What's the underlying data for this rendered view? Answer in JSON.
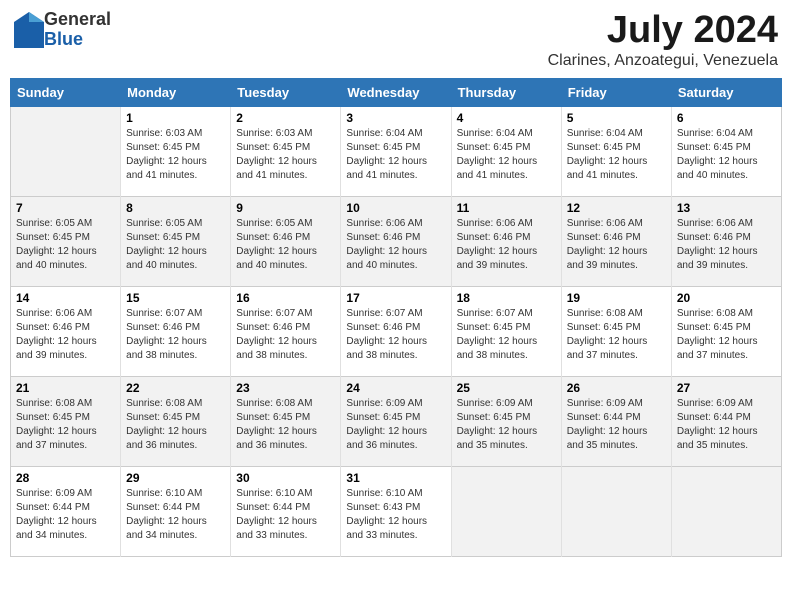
{
  "header": {
    "logo": {
      "line1": "General",
      "line2": "Blue"
    },
    "title": "July 2024",
    "location": "Clarines, Anzoategui, Venezuela"
  },
  "days_of_week": [
    "Sunday",
    "Monday",
    "Tuesday",
    "Wednesday",
    "Thursday",
    "Friday",
    "Saturday"
  ],
  "weeks": [
    [
      {
        "day": "",
        "sunrise": "",
        "sunset": "",
        "daylight": ""
      },
      {
        "day": "1",
        "sunrise": "Sunrise: 6:03 AM",
        "sunset": "Sunset: 6:45 PM",
        "daylight": "Daylight: 12 hours and 41 minutes."
      },
      {
        "day": "2",
        "sunrise": "Sunrise: 6:03 AM",
        "sunset": "Sunset: 6:45 PM",
        "daylight": "Daylight: 12 hours and 41 minutes."
      },
      {
        "day": "3",
        "sunrise": "Sunrise: 6:04 AM",
        "sunset": "Sunset: 6:45 PM",
        "daylight": "Daylight: 12 hours and 41 minutes."
      },
      {
        "day": "4",
        "sunrise": "Sunrise: 6:04 AM",
        "sunset": "Sunset: 6:45 PM",
        "daylight": "Daylight: 12 hours and 41 minutes."
      },
      {
        "day": "5",
        "sunrise": "Sunrise: 6:04 AM",
        "sunset": "Sunset: 6:45 PM",
        "daylight": "Daylight: 12 hours and 41 minutes."
      },
      {
        "day": "6",
        "sunrise": "Sunrise: 6:04 AM",
        "sunset": "Sunset: 6:45 PM",
        "daylight": "Daylight: 12 hours and 40 minutes."
      }
    ],
    [
      {
        "day": "7",
        "sunrise": "Sunrise: 6:05 AM",
        "sunset": "Sunset: 6:45 PM",
        "daylight": "Daylight: 12 hours and 40 minutes."
      },
      {
        "day": "8",
        "sunrise": "Sunrise: 6:05 AM",
        "sunset": "Sunset: 6:45 PM",
        "daylight": "Daylight: 12 hours and 40 minutes."
      },
      {
        "day": "9",
        "sunrise": "Sunrise: 6:05 AM",
        "sunset": "Sunset: 6:46 PM",
        "daylight": "Daylight: 12 hours and 40 minutes."
      },
      {
        "day": "10",
        "sunrise": "Sunrise: 6:06 AM",
        "sunset": "Sunset: 6:46 PM",
        "daylight": "Daylight: 12 hours and 40 minutes."
      },
      {
        "day": "11",
        "sunrise": "Sunrise: 6:06 AM",
        "sunset": "Sunset: 6:46 PM",
        "daylight": "Daylight: 12 hours and 39 minutes."
      },
      {
        "day": "12",
        "sunrise": "Sunrise: 6:06 AM",
        "sunset": "Sunset: 6:46 PM",
        "daylight": "Daylight: 12 hours and 39 minutes."
      },
      {
        "day": "13",
        "sunrise": "Sunrise: 6:06 AM",
        "sunset": "Sunset: 6:46 PM",
        "daylight": "Daylight: 12 hours and 39 minutes."
      }
    ],
    [
      {
        "day": "14",
        "sunrise": "Sunrise: 6:06 AM",
        "sunset": "Sunset: 6:46 PM",
        "daylight": "Daylight: 12 hours and 39 minutes."
      },
      {
        "day": "15",
        "sunrise": "Sunrise: 6:07 AM",
        "sunset": "Sunset: 6:46 PM",
        "daylight": "Daylight: 12 hours and 38 minutes."
      },
      {
        "day": "16",
        "sunrise": "Sunrise: 6:07 AM",
        "sunset": "Sunset: 6:46 PM",
        "daylight": "Daylight: 12 hours and 38 minutes."
      },
      {
        "day": "17",
        "sunrise": "Sunrise: 6:07 AM",
        "sunset": "Sunset: 6:46 PM",
        "daylight": "Daylight: 12 hours and 38 minutes."
      },
      {
        "day": "18",
        "sunrise": "Sunrise: 6:07 AM",
        "sunset": "Sunset: 6:45 PM",
        "daylight": "Daylight: 12 hours and 38 minutes."
      },
      {
        "day": "19",
        "sunrise": "Sunrise: 6:08 AM",
        "sunset": "Sunset: 6:45 PM",
        "daylight": "Daylight: 12 hours and 37 minutes."
      },
      {
        "day": "20",
        "sunrise": "Sunrise: 6:08 AM",
        "sunset": "Sunset: 6:45 PM",
        "daylight": "Daylight: 12 hours and 37 minutes."
      }
    ],
    [
      {
        "day": "21",
        "sunrise": "Sunrise: 6:08 AM",
        "sunset": "Sunset: 6:45 PM",
        "daylight": "Daylight: 12 hours and 37 minutes."
      },
      {
        "day": "22",
        "sunrise": "Sunrise: 6:08 AM",
        "sunset": "Sunset: 6:45 PM",
        "daylight": "Daylight: 12 hours and 36 minutes."
      },
      {
        "day": "23",
        "sunrise": "Sunrise: 6:08 AM",
        "sunset": "Sunset: 6:45 PM",
        "daylight": "Daylight: 12 hours and 36 minutes."
      },
      {
        "day": "24",
        "sunrise": "Sunrise: 6:09 AM",
        "sunset": "Sunset: 6:45 PM",
        "daylight": "Daylight: 12 hours and 36 minutes."
      },
      {
        "day": "25",
        "sunrise": "Sunrise: 6:09 AM",
        "sunset": "Sunset: 6:45 PM",
        "daylight": "Daylight: 12 hours and 35 minutes."
      },
      {
        "day": "26",
        "sunrise": "Sunrise: 6:09 AM",
        "sunset": "Sunset: 6:44 PM",
        "daylight": "Daylight: 12 hours and 35 minutes."
      },
      {
        "day": "27",
        "sunrise": "Sunrise: 6:09 AM",
        "sunset": "Sunset: 6:44 PM",
        "daylight": "Daylight: 12 hours and 35 minutes."
      }
    ],
    [
      {
        "day": "28",
        "sunrise": "Sunrise: 6:09 AM",
        "sunset": "Sunset: 6:44 PM",
        "daylight": "Daylight: 12 hours and 34 minutes."
      },
      {
        "day": "29",
        "sunrise": "Sunrise: 6:10 AM",
        "sunset": "Sunset: 6:44 PM",
        "daylight": "Daylight: 12 hours and 34 minutes."
      },
      {
        "day": "30",
        "sunrise": "Sunrise: 6:10 AM",
        "sunset": "Sunset: 6:44 PM",
        "daylight": "Daylight: 12 hours and 33 minutes."
      },
      {
        "day": "31",
        "sunrise": "Sunrise: 6:10 AM",
        "sunset": "Sunset: 6:43 PM",
        "daylight": "Daylight: 12 hours and 33 minutes."
      },
      {
        "day": "",
        "sunrise": "",
        "sunset": "",
        "daylight": ""
      },
      {
        "day": "",
        "sunrise": "",
        "sunset": "",
        "daylight": ""
      },
      {
        "day": "",
        "sunrise": "",
        "sunset": "",
        "daylight": ""
      }
    ]
  ]
}
